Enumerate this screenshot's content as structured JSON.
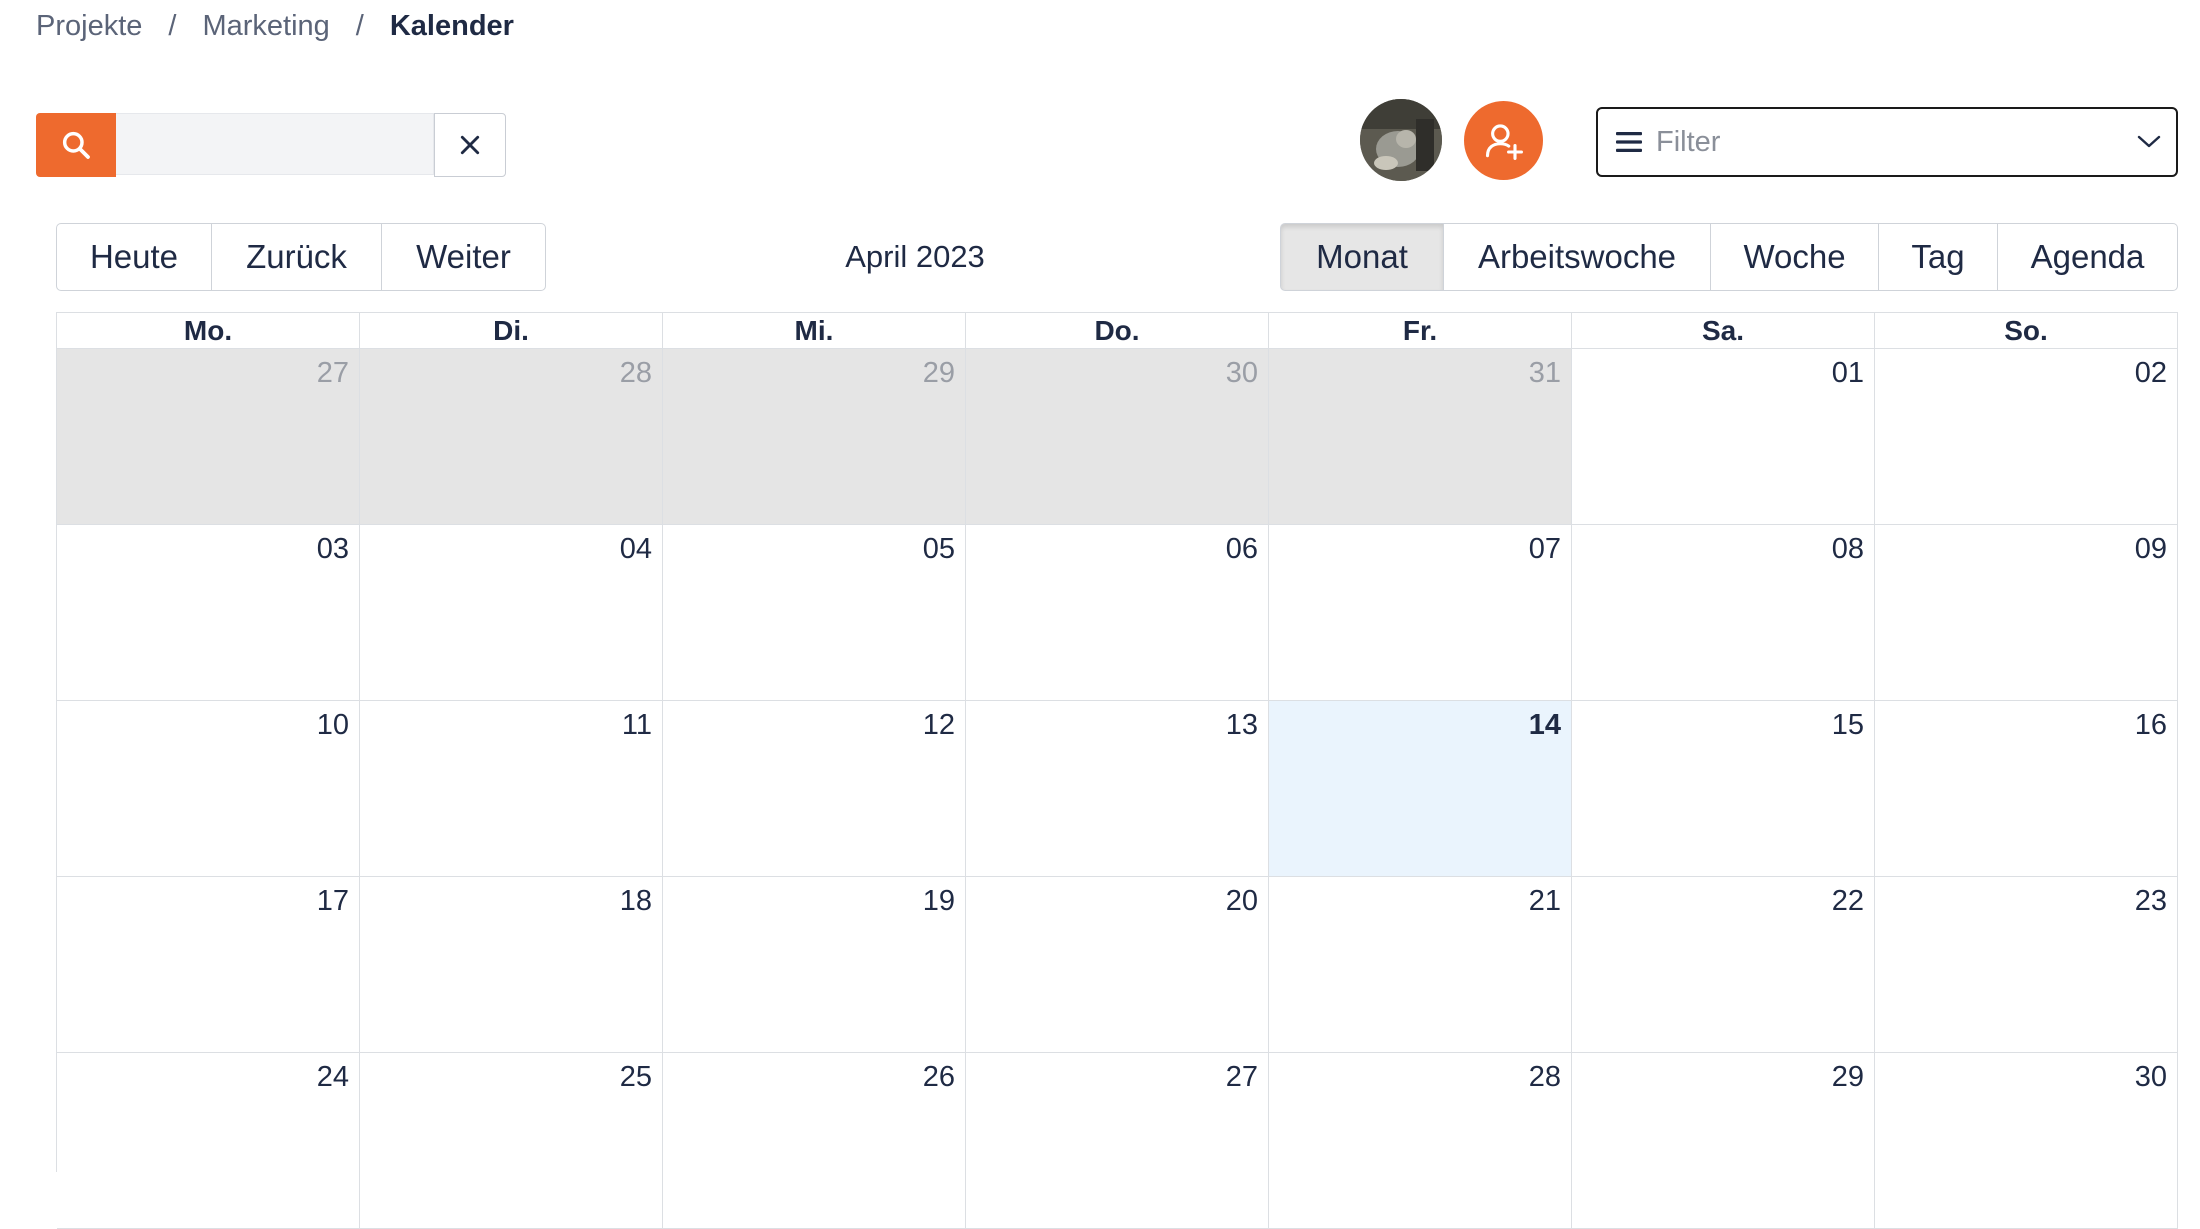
{
  "breadcrumb": {
    "items": [
      "Projekte",
      "Marketing",
      "Kalender"
    ],
    "separator": "/"
  },
  "search": {
    "value": "",
    "placeholder": ""
  },
  "filter": {
    "placeholder": "Filter"
  },
  "nav": {
    "today": "Heute",
    "back": "Zurück",
    "next": "Weiter"
  },
  "month_label": "April 2023",
  "views": [
    {
      "label": "Monat",
      "active": true
    },
    {
      "label": "Arbeitswoche",
      "active": false
    },
    {
      "label": "Woche",
      "active": false
    },
    {
      "label": "Tag",
      "active": false
    },
    {
      "label": "Agenda",
      "active": false
    }
  ],
  "weekdays": [
    "Mo.",
    "Di.",
    "Mi.",
    "Do.",
    "Fr.",
    "Sa.",
    "So."
  ],
  "weeks": [
    [
      {
        "label": "27",
        "off": true
      },
      {
        "label": "28",
        "off": true
      },
      {
        "label": "29",
        "off": true
      },
      {
        "label": "30",
        "off": true
      },
      {
        "label": "31",
        "off": true
      },
      {
        "label": "01"
      },
      {
        "label": "02"
      }
    ],
    [
      {
        "label": "03"
      },
      {
        "label": "04"
      },
      {
        "label": "05"
      },
      {
        "label": "06"
      },
      {
        "label": "07"
      },
      {
        "label": "08"
      },
      {
        "label": "09"
      }
    ],
    [
      {
        "label": "10"
      },
      {
        "label": "11"
      },
      {
        "label": "12"
      },
      {
        "label": "13"
      },
      {
        "label": "14",
        "today": true
      },
      {
        "label": "15"
      },
      {
        "label": "16"
      }
    ],
    [
      {
        "label": "17"
      },
      {
        "label": "18"
      },
      {
        "label": "19"
      },
      {
        "label": "20"
      },
      {
        "label": "21"
      },
      {
        "label": "22"
      },
      {
        "label": "23"
      }
    ],
    [
      {
        "label": "24"
      },
      {
        "label": "25"
      },
      {
        "label": "26"
      },
      {
        "label": "27"
      },
      {
        "label": "28"
      },
      {
        "label": "29"
      },
      {
        "label": "30"
      }
    ]
  ],
  "colors": {
    "accent": "#ee6a2e",
    "today_bg": "#eaf4fd",
    "off_bg": "#e5e5e5"
  },
  "icons": {
    "search": "search-icon",
    "clear": "close-icon",
    "add_user": "add-user-icon",
    "filter_menu": "menu-icon",
    "filter_chevron": "chevron-down-icon"
  }
}
